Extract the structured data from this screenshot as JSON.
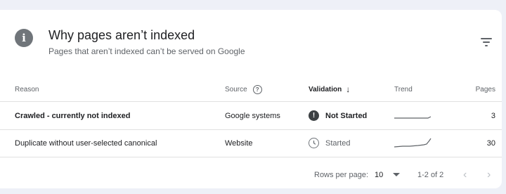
{
  "card": {
    "title": "Why pages aren’t indexed",
    "subtitle": "Pages that aren’t indexed can’t be served on Google",
    "info_icon_glyph": "i"
  },
  "table": {
    "headers": {
      "reason": "Reason",
      "source": "Source",
      "validation": "Validation",
      "trend": "Trend",
      "pages": "Pages"
    },
    "help_glyph": "?",
    "sort_glyph": "↓",
    "rows": [
      {
        "reason": "Crawled - currently not indexed",
        "source": "Google systems",
        "validation": "Not Started",
        "validation_glyph": "!",
        "pages": "3"
      },
      {
        "reason": "Duplicate without user-selected canonical",
        "source": "Website",
        "validation": "Started",
        "pages": "30"
      }
    ]
  },
  "footer": {
    "rows_per_page_label": "Rows per page:",
    "rows_per_page_value": "10",
    "range": "1-2 of 2",
    "prev_glyph": "‹",
    "next_glyph": "›"
  },
  "colors": {
    "background": "#eef0f7",
    "card": "#ffffff",
    "not_started_icon": "#3c4043",
    "muted_text": "#5f6368"
  }
}
